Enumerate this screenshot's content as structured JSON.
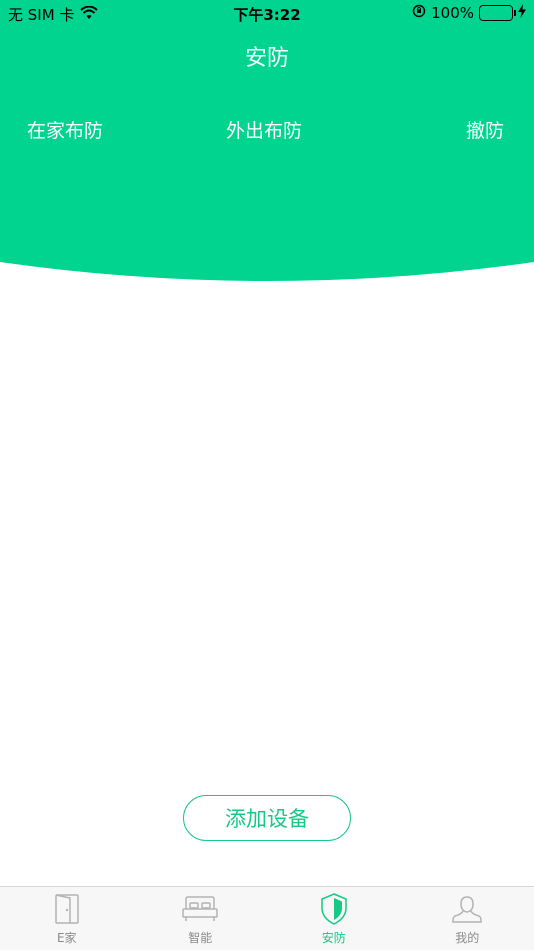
{
  "status_bar": {
    "carrier": "无 SIM 卡",
    "time": "下午3:22",
    "battery": "100%",
    "battery_level": 1.0
  },
  "header": {
    "title": "安防",
    "modes": [
      {
        "label": "在家布防"
      },
      {
        "label": "外出布防"
      },
      {
        "label": "撤防"
      }
    ]
  },
  "main": {
    "add_device_label": "添加设备"
  },
  "tabbar": {
    "active": "安防",
    "items": [
      {
        "label": "E家",
        "icon": "door-icon"
      },
      {
        "label": "智能",
        "icon": "bed-icon"
      },
      {
        "label": "安防",
        "icon": "shield-icon"
      },
      {
        "label": "我的",
        "icon": "person-icon"
      }
    ]
  },
  "colors": {
    "accent": "#00d48e",
    "button_border": "#17c886",
    "tab_inactive": "#8a8a8a",
    "battery": "#19c940"
  }
}
